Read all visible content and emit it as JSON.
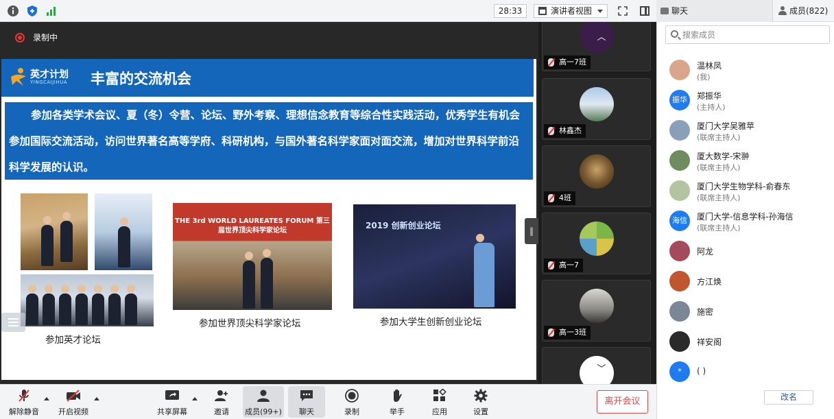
{
  "topbar": {
    "timer": "28:33",
    "view_mode": "演讲者视图"
  },
  "panel_tabs": {
    "chat": "聊天",
    "members": "成员(822)"
  },
  "stage": {
    "recording_label": "录制中"
  },
  "slide": {
    "logo_main": "英才计划",
    "logo_sub": "YINGCAIJIHUA",
    "title": "丰富的交流机会",
    "paragraph": "参加各类学术会议、夏（冬）令营、论坛、野外考察、理想信念教育等综合性实践活动，优秀学生有机会参加国际交流活动，访问世界著名高等学府、科研机构，与国外著名科学家面对面交流，增加对世界科学前沿科学发展的认识。",
    "photo_forum_band": "THE 3rd WORLD LAUREATES FORUM 第三届世界顶尖科学家论坛",
    "photo_innovation_band": "2019 创新创业论坛",
    "captions": [
      "参加英才论坛",
      "参加世界顶尖科学家论坛",
      "参加大学生创新创业论坛"
    ]
  },
  "video_tiles": [
    {
      "name": "高一7班",
      "color": "#3b1d4a"
    },
    {
      "name": "林鑫杰",
      "color": "#6d8fb5"
    },
    {
      "name": "4班",
      "color": "#5a4a2a"
    },
    {
      "name": "高一7",
      "color": "#7a9a3c"
    },
    {
      "name": "高一3班",
      "color": "#8c8a84"
    }
  ],
  "toolbar": {
    "unmute": "解除静音",
    "start_video": "开启视频",
    "share_screen": "共享屏幕",
    "invite": "邀请",
    "members": "成员(99+)",
    "chat": "聊天",
    "record": "录制",
    "raise_hand": "举手",
    "apps": "应用",
    "settings": "设置",
    "leave": "离开会议"
  },
  "panel": {
    "search_placeholder": "搜索成员",
    "members": [
      {
        "name": "温林凤",
        "role": "(我)",
        "avatar_text": "",
        "avatar_color": "#d9a58b"
      },
      {
        "name": "郑振华",
        "role": "(主持人)",
        "avatar_text": "振华",
        "avatar_color": "#1f7cf0"
      },
      {
        "name": "厦门大学吴雅苹",
        "role": "(联席主持人)",
        "avatar_text": "",
        "avatar_color": "#8aa0b8"
      },
      {
        "name": "厦大数学-宋翀",
        "role": "(联席主持人)",
        "avatar_text": "",
        "avatar_color": "#6f8c5e"
      },
      {
        "name": "厦门大学生物学科-俞春东",
        "role": "(联席主持人)",
        "avatar_text": "",
        "avatar_color": "#b3c4a0"
      },
      {
        "name": "厦门大学-信息学科-孙海信",
        "role": "(联席主持人)",
        "avatar_text": "海信",
        "avatar_color": "#1f7cf0"
      },
      {
        "name": "阿龙",
        "role": "",
        "avatar_text": "",
        "avatar_color": "#a44a5c"
      },
      {
        "name": "方江焕",
        "role": "",
        "avatar_text": "",
        "avatar_color": "#c0562e"
      },
      {
        "name": "施密",
        "role": "",
        "avatar_text": "",
        "avatar_color": "#7b8794"
      },
      {
        "name": "祥安阁",
        "role": "",
        "avatar_text": "",
        "avatar_color": "#2a2a2a"
      },
      {
        "name": "( )",
        "role": "",
        "avatar_text": "*",
        "avatar_color": "#1f7cf0"
      }
    ],
    "rename": "改名"
  }
}
